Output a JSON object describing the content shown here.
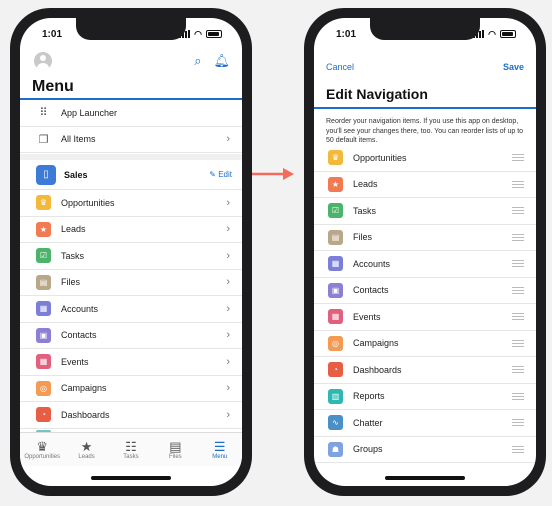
{
  "left": {
    "time": "1:01",
    "title": "Menu",
    "top_items": [
      {
        "label": "App Launcher",
        "icon": "grid-icon"
      },
      {
        "label": "All Items",
        "icon": "stack-icon"
      }
    ],
    "section": {
      "label": "Sales",
      "edit_label": "Edit"
    },
    "items": [
      {
        "label": "Opportunities",
        "icon": "crown-icon",
        "color": "#f4b93a",
        "glyph": "♛"
      },
      {
        "label": "Leads",
        "icon": "star-icon",
        "color": "#f27a53",
        "glyph": "★"
      },
      {
        "label": "Tasks",
        "icon": "checklist-icon",
        "color": "#4cb36b",
        "glyph": "☑"
      },
      {
        "label": "Files",
        "icon": "file-icon",
        "color": "#b9a78a",
        "glyph": "▤"
      },
      {
        "label": "Accounts",
        "icon": "building-icon",
        "color": "#7b7fd8",
        "glyph": "▦"
      },
      {
        "label": "Contacts",
        "icon": "contact-card-icon",
        "color": "#8c7fd6",
        "glyph": "▣"
      },
      {
        "label": "Events",
        "icon": "calendar-icon",
        "color": "#e0607e",
        "glyph": "▦"
      },
      {
        "label": "Campaigns",
        "icon": "target-icon",
        "color": "#f39a55",
        "glyph": "◎"
      },
      {
        "label": "Dashboards",
        "icon": "gauge-icon",
        "color": "#e75e45",
        "glyph": "◔"
      }
    ],
    "tabs": [
      {
        "label": "Opportunities",
        "icon": "crown-icon",
        "glyph": "♛",
        "active": false
      },
      {
        "label": "Leads",
        "icon": "star-icon",
        "glyph": "★",
        "active": false
      },
      {
        "label": "Tasks",
        "icon": "checklist-icon",
        "glyph": "☷",
        "active": false
      },
      {
        "label": "Files",
        "icon": "file-icon",
        "glyph": "▤",
        "active": false
      },
      {
        "label": "Menu",
        "icon": "hamburger-icon",
        "glyph": "☰",
        "active": true
      }
    ]
  },
  "right": {
    "time": "1:01",
    "cancel_label": "Cancel",
    "save_label": "Save",
    "title": "Edit Navigation",
    "description": "Reorder your navigation items. If you use this app on desktop, you'll see your changes there, too. You can reorder lists of up to 50 default items.",
    "items": [
      {
        "label": "Opportunities",
        "icon": "crown-icon",
        "color": "#f4b93a",
        "glyph": "♛"
      },
      {
        "label": "Leads",
        "icon": "star-icon",
        "color": "#f27a53",
        "glyph": "★"
      },
      {
        "label": "Tasks",
        "icon": "checklist-icon",
        "color": "#4cb36b",
        "glyph": "☑"
      },
      {
        "label": "Files",
        "icon": "file-icon",
        "color": "#b9a78a",
        "glyph": "▤"
      },
      {
        "label": "Accounts",
        "icon": "building-icon",
        "color": "#7b7fd8",
        "glyph": "▦"
      },
      {
        "label": "Contacts",
        "icon": "contact-card-icon",
        "color": "#8c7fd6",
        "glyph": "▣"
      },
      {
        "label": "Events",
        "icon": "calendar-icon",
        "color": "#e0607e",
        "glyph": "▦"
      },
      {
        "label": "Campaigns",
        "icon": "target-icon",
        "color": "#f39a55",
        "glyph": "◎"
      },
      {
        "label": "Dashboards",
        "icon": "gauge-icon",
        "color": "#e75e45",
        "glyph": "◔"
      },
      {
        "label": "Reports",
        "icon": "report-icon",
        "color": "#2fb8b1",
        "glyph": "▥"
      },
      {
        "label": "Chatter",
        "icon": "pulse-icon",
        "color": "#4a90c8",
        "glyph": "∿"
      },
      {
        "label": "Groups",
        "icon": "people-icon",
        "color": "#7fa2e0",
        "glyph": "☗"
      }
    ]
  },
  "arrow_color": "#f26b5b"
}
